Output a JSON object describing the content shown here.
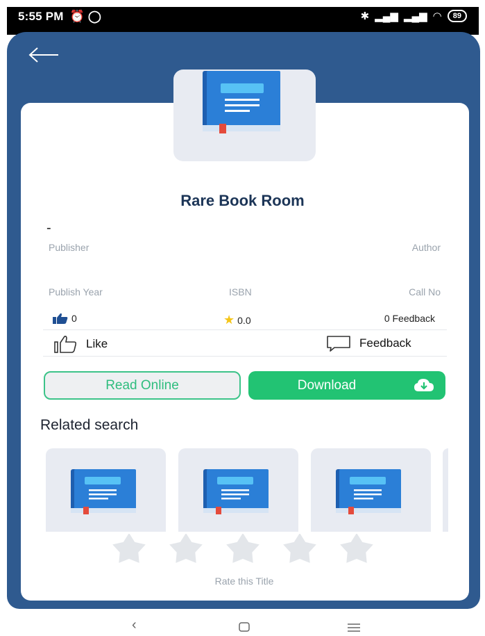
{
  "status": {
    "time": "5:55 PM",
    "battery": "89"
  },
  "book": {
    "title": "Rare Book Room",
    "dash": "-"
  },
  "labels": {
    "publisher": "Publisher",
    "author": "Author",
    "publish_year": "Publish Year",
    "isbn": "ISBN",
    "call_no": "Call No"
  },
  "stats": {
    "likes": "0",
    "rating": "0.0",
    "feedback_count": "0 Feedback"
  },
  "actions": {
    "like": "Like",
    "feedback": "Feedback"
  },
  "buttons": {
    "read_online": "Read Online",
    "download": "Download"
  },
  "related": {
    "heading": "Related search",
    "items": [
      {},
      {},
      {}
    ]
  },
  "rating": {
    "prompt": "Rate this Title",
    "stars_selected": 0,
    "stars_total": 5
  },
  "icons": {
    "back": "arrow-left-icon",
    "book": "book-icon",
    "thumbs_up": "thumbs-up-icon",
    "star": "star-icon",
    "like": "like-outline-icon",
    "feedback": "chat-bubble-icon",
    "download": "cloud-download-icon"
  },
  "colors": {
    "header": "#2f5a8f",
    "primary_green": "#22c373",
    "title_navy": "#1c3557",
    "star_empty": "#e3e6ea",
    "star_filled": "#f5c518"
  }
}
